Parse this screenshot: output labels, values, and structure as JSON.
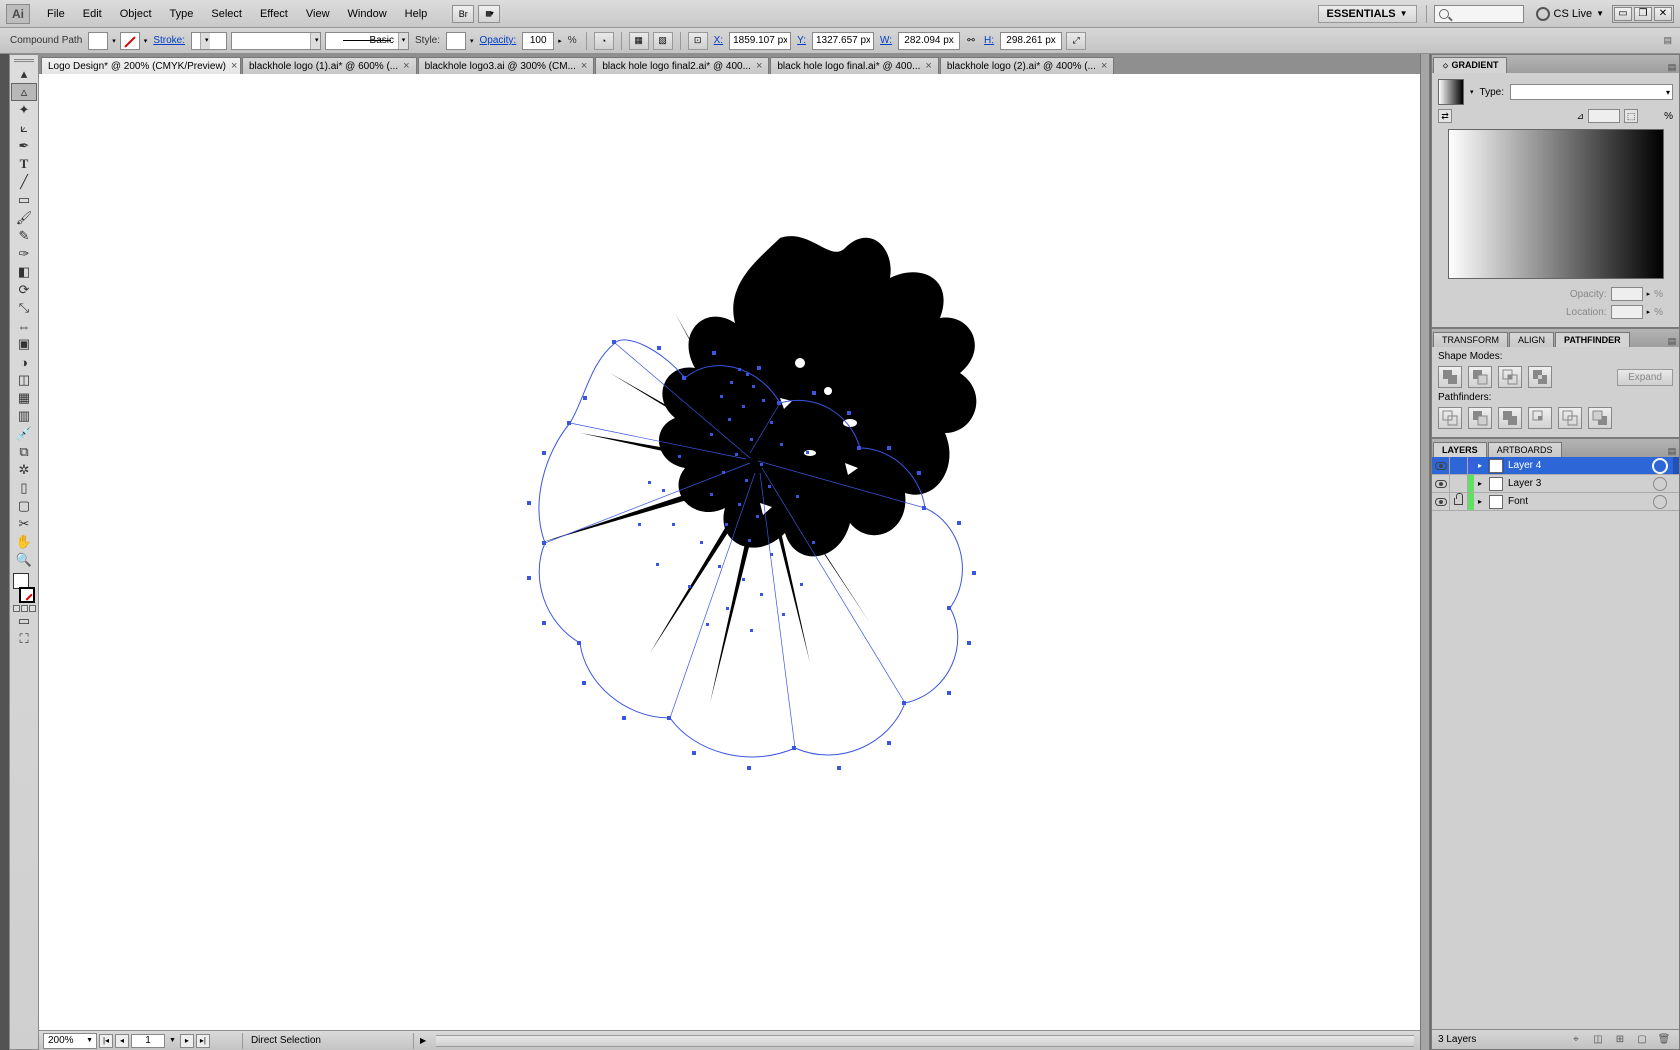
{
  "app_logo": "Ai",
  "menu": [
    "File",
    "Edit",
    "Object",
    "Type",
    "Select",
    "Effect",
    "View",
    "Window",
    "Help"
  ],
  "workspace": "ESSENTIALS",
  "cslive": "CS Live",
  "controlbar": {
    "selection_label": "Compound Path",
    "stroke_label": "Stroke:",
    "brush_label": "Basic",
    "style_label": "Style:",
    "opacity_label": "Opacity:",
    "opacity_value": "100",
    "opacity_pct": "%",
    "x_label": "X:",
    "x_value": "1859.107 px",
    "y_label": "Y:",
    "y_value": "1327.657 px",
    "w_label": "W:",
    "w_value": "282.094 px",
    "h_label": "H:",
    "h_value": "298.261 px"
  },
  "tabs": [
    {
      "label": "Logo Design* @ 200% (CMYK/Preview)",
      "active": true
    },
    {
      "label": "blackhole logo (1).ai* @ 600% (...",
      "active": false
    },
    {
      "label": "blackhole logo3.ai @ 300% (CM...",
      "active": false
    },
    {
      "label": "black hole logo final2.ai* @ 400...",
      "active": false
    },
    {
      "label": "black hole logo final.ai* @ 400...",
      "active": false
    },
    {
      "label": "blackhole logo (2).ai* @ 400% (...",
      "active": false
    }
  ],
  "status": {
    "zoom": "200%",
    "page": "1",
    "info": "Direct Selection"
  },
  "panels": {
    "gradient": {
      "title": "GRADIENT",
      "type_label": "Type:",
      "opacity_label": "Opacity:",
      "location_label": "Location:",
      "pct": "%"
    },
    "pathfinder": {
      "tabs": [
        "TRANSFORM",
        "ALIGN",
        "PATHFINDER"
      ],
      "active": 2,
      "shape_modes_label": "Shape Modes:",
      "pathfinders_label": "Pathfinders:",
      "expand": "Expand"
    },
    "layers": {
      "tabs": [
        "LAYERS",
        "ARTBOARDS"
      ],
      "active": 0,
      "items": [
        {
          "name": "Layer 4",
          "color": "#3a60e0",
          "selected": true
        },
        {
          "name": "Layer 3",
          "color": "#60e060",
          "selected": false
        },
        {
          "name": "Font",
          "color": "#60e060",
          "selected": false,
          "locked": true
        }
      ],
      "footer_count": "3 Layers"
    }
  },
  "tools": [
    "selection",
    "direct-selection",
    "magic-wand",
    "lasso",
    "pen",
    "type",
    "line",
    "rectangle",
    "paintbrush",
    "pencil",
    "blob-brush",
    "eraser",
    "rotate",
    "scale",
    "width",
    "free-transform",
    "shape-builder",
    "perspective",
    "mesh",
    "gradient",
    "eyedropper",
    "blend",
    "symbol-sprayer",
    "column-graph",
    "artboard",
    "slice",
    "hand",
    "zoom"
  ]
}
